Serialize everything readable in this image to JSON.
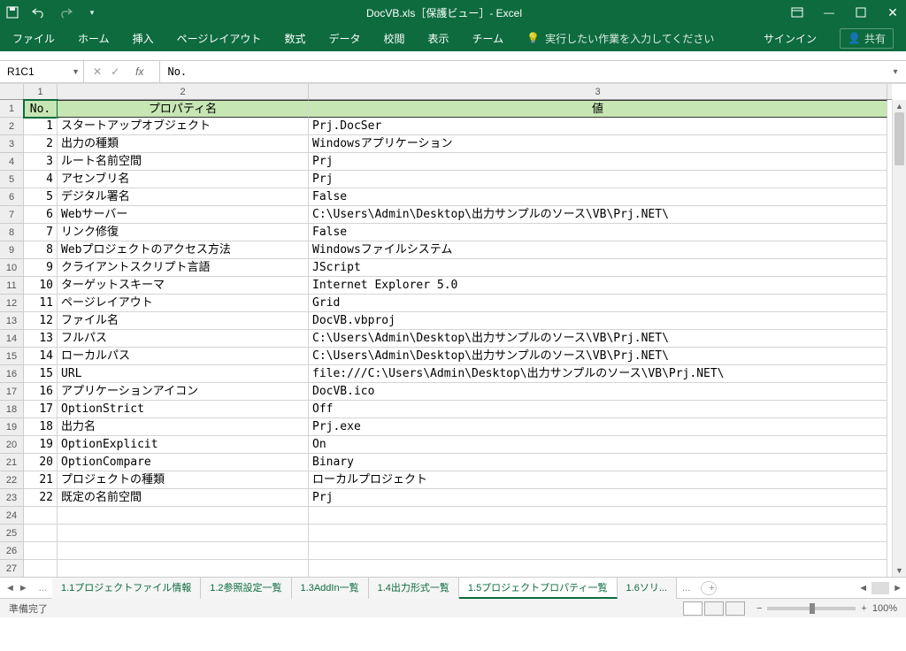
{
  "window": {
    "title": "DocVB.xls［保護ビュー］- Excel"
  },
  "qat": {
    "save": "save",
    "undo": "undo",
    "redo": "redo"
  },
  "winctrls": {
    "ribbonOpts": "⊞",
    "min": "—",
    "max": "▢",
    "close": "✕"
  },
  "ribbon": {
    "file": "ファイル",
    "home": "ホーム",
    "insert": "挿入",
    "layout": "ページレイアウト",
    "formulas": "数式",
    "data": "データ",
    "review": "校閲",
    "view": "表示",
    "team": "チーム",
    "tell": "実行したい作業を入力してください",
    "signin": "サインイン",
    "share": "共有"
  },
  "namebox": "R1C1",
  "formula": {
    "fx": "fx",
    "value": "No."
  },
  "columns": {
    "c1": "1",
    "c2": "2",
    "c3": "3"
  },
  "colWidths": {
    "c1": 38,
    "c2": 284,
    "c3": 654
  },
  "headers": {
    "no": "No.",
    "prop": "プロパティ名",
    "val": "値"
  },
  "rows": [
    {
      "n": "1",
      "p": "スタートアップオブジェクト",
      "v": "Prj.DocSer"
    },
    {
      "n": "2",
      "p": "出力の種類",
      "v": "Windowsアプリケーション"
    },
    {
      "n": "3",
      "p": "ルート名前空間",
      "v": "Prj"
    },
    {
      "n": "4",
      "p": "アセンブリ名",
      "v": "Prj"
    },
    {
      "n": "5",
      "p": "デジタル署名",
      "v": "False"
    },
    {
      "n": "6",
      "p": "Webサーバー",
      "v": "C:\\Users\\Admin\\Desktop\\出力サンプルのソース\\VB\\Prj.NET\\"
    },
    {
      "n": "7",
      "p": "リンク修復",
      "v": "False"
    },
    {
      "n": "8",
      "p": "Webプロジェクトのアクセス方法",
      "v": "Windowsファイルシステム"
    },
    {
      "n": "9",
      "p": "クライアントスクリプト言語",
      "v": "JScript"
    },
    {
      "n": "10",
      "p": "ターゲットスキーマ",
      "v": "Internet Explorer 5.0"
    },
    {
      "n": "11",
      "p": "ページレイアウト",
      "v": "Grid"
    },
    {
      "n": "12",
      "p": "ファイル名",
      "v": "DocVB.vbproj"
    },
    {
      "n": "13",
      "p": "フルパス",
      "v": "C:\\Users\\Admin\\Desktop\\出力サンプルのソース\\VB\\Prj.NET\\"
    },
    {
      "n": "14",
      "p": "ローカルパス",
      "v": "C:\\Users\\Admin\\Desktop\\出力サンプルのソース\\VB\\Prj.NET\\"
    },
    {
      "n": "15",
      "p": "URL",
      "v": "file:///C:\\Users\\Admin\\Desktop\\出力サンプルのソース\\VB\\Prj.NET\\"
    },
    {
      "n": "16",
      "p": "アプリケーションアイコン",
      "v": "DocVB.ico"
    },
    {
      "n": "17",
      "p": "OptionStrict",
      "v": "Off"
    },
    {
      "n": "18",
      "p": "出力名",
      "v": "Prj.exe"
    },
    {
      "n": "19",
      "p": "OptionExplicit",
      "v": "On"
    },
    {
      "n": "20",
      "p": "OptionCompare",
      "v": "Binary"
    },
    {
      "n": "21",
      "p": "プロジェクトの種類",
      "v": "ローカルプロジェクト"
    },
    {
      "n": "22",
      "p": "既定の名前空間",
      "v": "Prj"
    }
  ],
  "emptyRows": [
    24,
    25,
    26,
    27
  ],
  "sheets": {
    "more": "...",
    "tabs": [
      "1.1プロジェクトファイル情報",
      "1.2参照設定一覧",
      "1.3AddIn一覧",
      "1.4出力形式一覧",
      "1.5プロジェクトプロパティ一覧",
      "1.6ソリ..."
    ],
    "activeIndex": 4,
    "trailingMore": "..."
  },
  "status": {
    "ready": "準備完了",
    "zoom": "100%"
  }
}
